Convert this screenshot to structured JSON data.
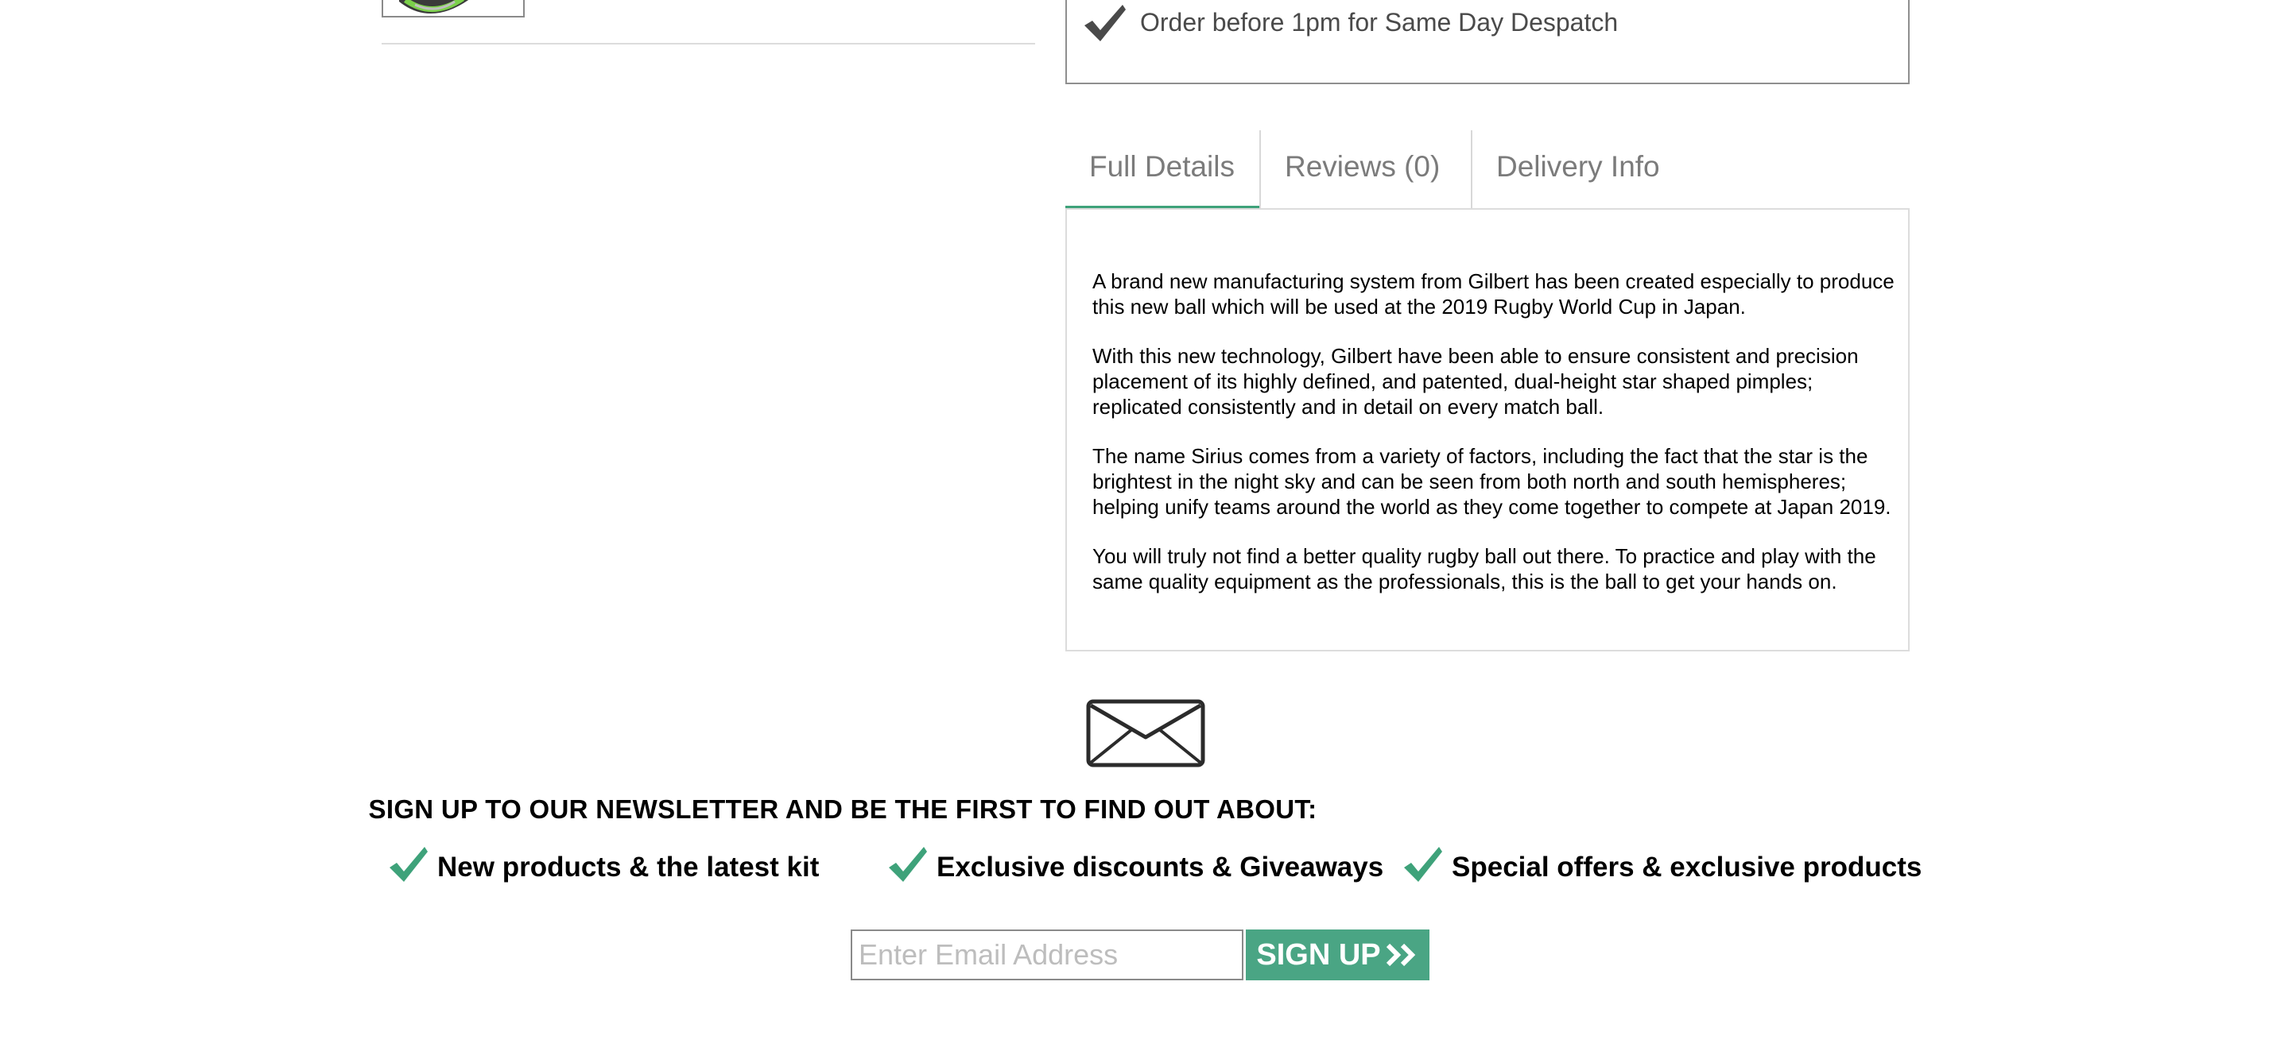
{
  "despatch": {
    "text": "Order before 1pm for Same Day Despatch",
    "icon": "checkmark-icon"
  },
  "tabs": [
    {
      "label": "Full Details",
      "active": true
    },
    {
      "label": "Reviews (0)",
      "active": false
    },
    {
      "label": "Delivery Info",
      "active": false
    }
  ],
  "details": {
    "paragraphs": [
      "A brand new manufacturing system from Gilbert has been created especially to produce this new ball which will be used at the 2019 Rugby World Cup in Japan.",
      "With this new technology, Gilbert have been able to ensure consistent and precision placement of its highly defined, and patented, dual-height star shaped pimples; replicated consistently and in detail on every match ball.",
      "The name Sirius comes from a variety of factors, including the fact that the star is the brightest in the night sky and can be seen from both north and south hemispheres; helping unify teams around the world as they come together to compete at Japan 2019.",
      "You will truly not find a better quality rugby ball out there. To practice and play with the same quality equipment as the professionals, this is the ball to get your hands on."
    ]
  },
  "newsletter": {
    "icon": "envelope-icon",
    "heading": "SIGN UP TO OUR NEWSLETTER AND BE THE FIRST TO FIND OUT ABOUT:",
    "benefits": [
      "New products & the latest kit",
      "Exclusive discounts & Giveaways",
      "Special offers & exclusive products"
    ],
    "email_placeholder": "Enter Email Address",
    "signup_label": "SIGN UP"
  },
  "colors": {
    "accent": "#3ea27a",
    "button": "#4aa584",
    "tab_text": "#7b7b7b",
    "despatch_text": "#4a4a4a"
  }
}
